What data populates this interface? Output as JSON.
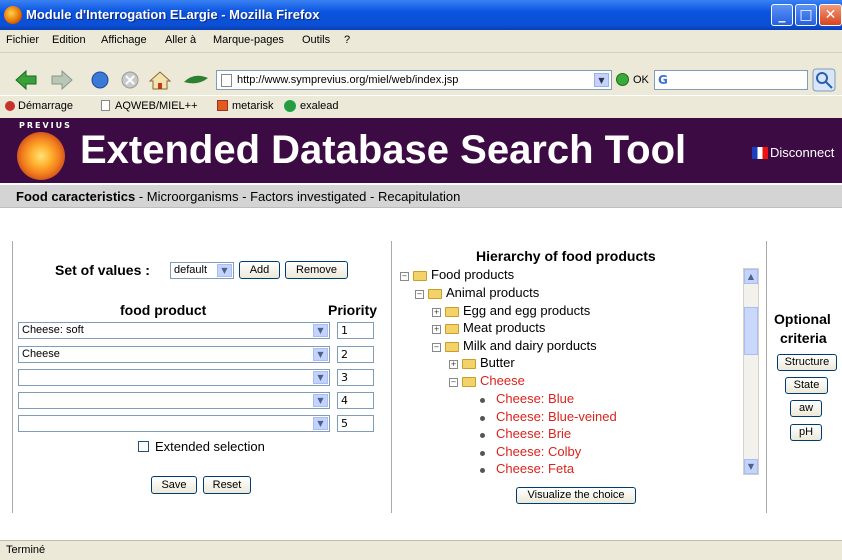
{
  "window": {
    "title": "Module d'Interrogation ELargie - Mozilla Firefox"
  },
  "menubar": [
    "Fichier",
    "Edition",
    "Affichage",
    "Aller à",
    "Marque-pages",
    "Outils",
    "?"
  ],
  "navbar": {
    "url": "http://www.symprevius.org/miel/web/index.jsp",
    "go_label": "OK",
    "search_logo": "G"
  },
  "bookmarks": [
    "Démarrage",
    "AQWEB/MIEL++",
    "metarisk",
    "exalead"
  ],
  "banner": {
    "small_text": "PREVIUS",
    "title": "Extended Database Search Tool",
    "disconnect": "Disconnect"
  },
  "breadcrumb": {
    "active": "Food caracteristics",
    "rest": " - Microorganisms - Factors investigated - Recapitulation"
  },
  "left": {
    "set_label": "Set of values :",
    "set_value": "default",
    "add": "Add",
    "remove": "Remove",
    "col_food": "food product",
    "col_priority": "Priority",
    "rows": [
      {
        "food": "Cheese: soft",
        "priority": "1"
      },
      {
        "food": "Cheese",
        "priority": "2"
      },
      {
        "food": "",
        "priority": "3"
      },
      {
        "food": "",
        "priority": "4"
      },
      {
        "food": "",
        "priority": "5"
      }
    ],
    "extended": "Extended selection",
    "save": "Save",
    "reset": "Reset"
  },
  "middle": {
    "title": "Hierarchy of food products",
    "tree": [
      "Food products",
      "Animal products",
      "Egg and egg products",
      "Meat products",
      "Milk and dairy porducts",
      "Butter",
      "Cheese",
      "Cheese: Blue",
      "Cheese: Blue-veined",
      "Cheese: Brie",
      "Cheese: Colby",
      "Cheese: Feta"
    ],
    "visualize": "Visualize the choice"
  },
  "right": {
    "title1": "Optional",
    "title2": "criteria",
    "buttons": [
      "Structure",
      "State",
      "aw",
      "pH"
    ]
  },
  "status": "Terminé"
}
